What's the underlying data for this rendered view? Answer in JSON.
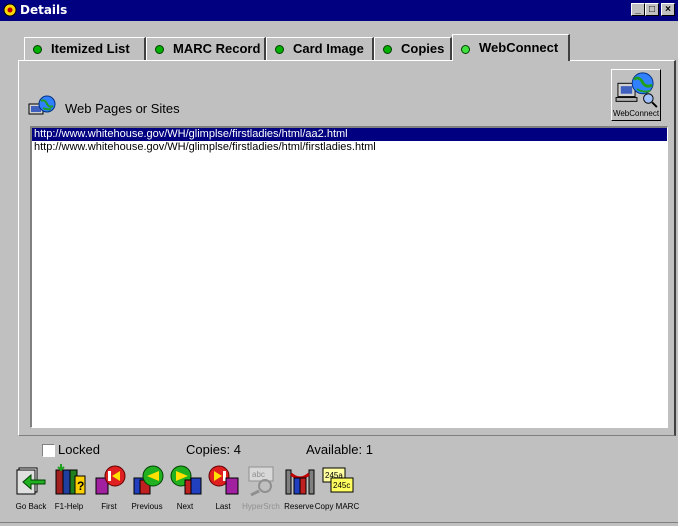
{
  "window": {
    "title": "Details",
    "controls": [
      "_",
      "□",
      "×"
    ]
  },
  "tabs": [
    {
      "label": "Itemized List",
      "active": false
    },
    {
      "label": "MARC Record",
      "active": false
    },
    {
      "label": "Card Image",
      "active": false
    },
    {
      "label": "Copies",
      "active": false
    },
    {
      "label": "WebConnect",
      "active": true
    }
  ],
  "panel": {
    "heading": "Web Pages or Sites",
    "webconnect_label": "WebConnect",
    "urls": [
      "http://www.whitehouse.gov/WH/glimplse/firstladies/html/aa2.html",
      "http://www.whitehouse.gov/WH/glimplse/firstladies/html/firstladies.html"
    ],
    "selected_index": 0
  },
  "status": {
    "locked_label": "Locked",
    "locked_checked": false,
    "copies": "Copies: 4",
    "available": "Available: 1"
  },
  "toolbar": [
    {
      "label": "Go Back",
      "icon": "go-back-icon",
      "enabled": true
    },
    {
      "label": "F1-Help",
      "icon": "help-books-icon",
      "enabled": true
    },
    {
      "label": "First",
      "icon": "first-icon",
      "enabled": true
    },
    {
      "label": "Previous",
      "icon": "previous-icon",
      "enabled": true
    },
    {
      "label": "Next",
      "icon": "next-icon",
      "enabled": true
    },
    {
      "label": "Last",
      "icon": "last-icon",
      "enabled": true
    },
    {
      "label": "HyperSrch",
      "icon": "hypersearch-icon",
      "enabled": false
    },
    {
      "label": "Reserve",
      "icon": "reserve-icon",
      "enabled": true
    },
    {
      "label": "Copy MARC",
      "icon": "copy-marc-icon",
      "enabled": true
    }
  ],
  "copy_marc_tags": [
    "245a",
    "245c"
  ],
  "colors": {
    "titlebar": "#000080",
    "selection": "#000080",
    "tab_dot": "#00b000",
    "face": "#c0c0c0"
  }
}
